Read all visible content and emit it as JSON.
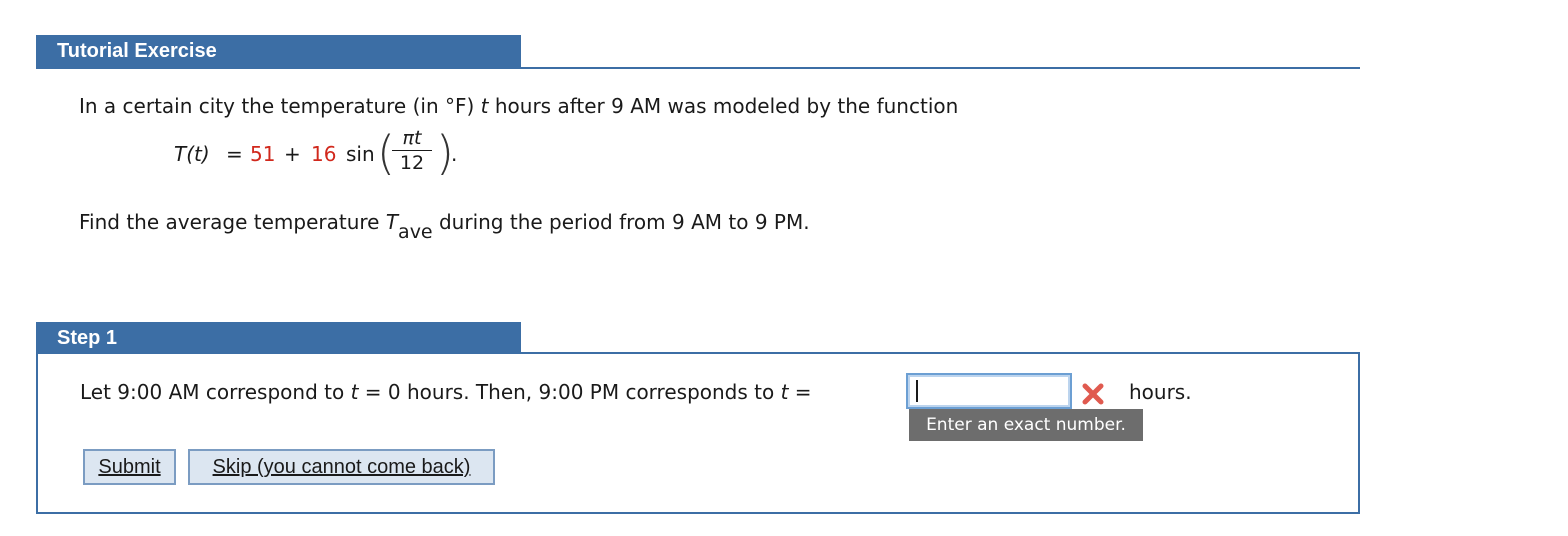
{
  "header": {
    "title": "Tutorial Exercise"
  },
  "question": {
    "intro_pre": "In a certain city the temperature (in °F) ",
    "intro_var": "t",
    "intro_post": " hours after 9 AM was modeled by the function",
    "equation": {
      "lhs": "T(t)",
      "equals": "=",
      "constant": "51",
      "plus": "+",
      "amplitude": "16",
      "func": "sin",
      "numerator": "πt",
      "denominator": "12",
      "period_end": ".",
      "accent_color": "#d1281c"
    },
    "find_pre": "Find the average temperature ",
    "find_var": "T",
    "find_sub": "ave",
    "find_post": " during the period from 9 AM to 9 PM."
  },
  "step1": {
    "title": "Step 1",
    "text_1": "Let 9:00 AM correspond to ",
    "var_1": "t",
    "text_2": " = 0 hours. Then, 9:00 PM corresponds to ",
    "var_2": "t",
    "text_3": " =",
    "input_value": "",
    "status_icon": "incorrect-x-icon",
    "unit": "hours.",
    "hint": "Enter an exact number."
  },
  "buttons": {
    "submit": "Submit",
    "skip": "Skip (you cannot come back)"
  },
  "colors": {
    "header_bg": "#3c6ea5",
    "error_red": "#e05a4f",
    "hint_bg": "#6d6d6d"
  }
}
